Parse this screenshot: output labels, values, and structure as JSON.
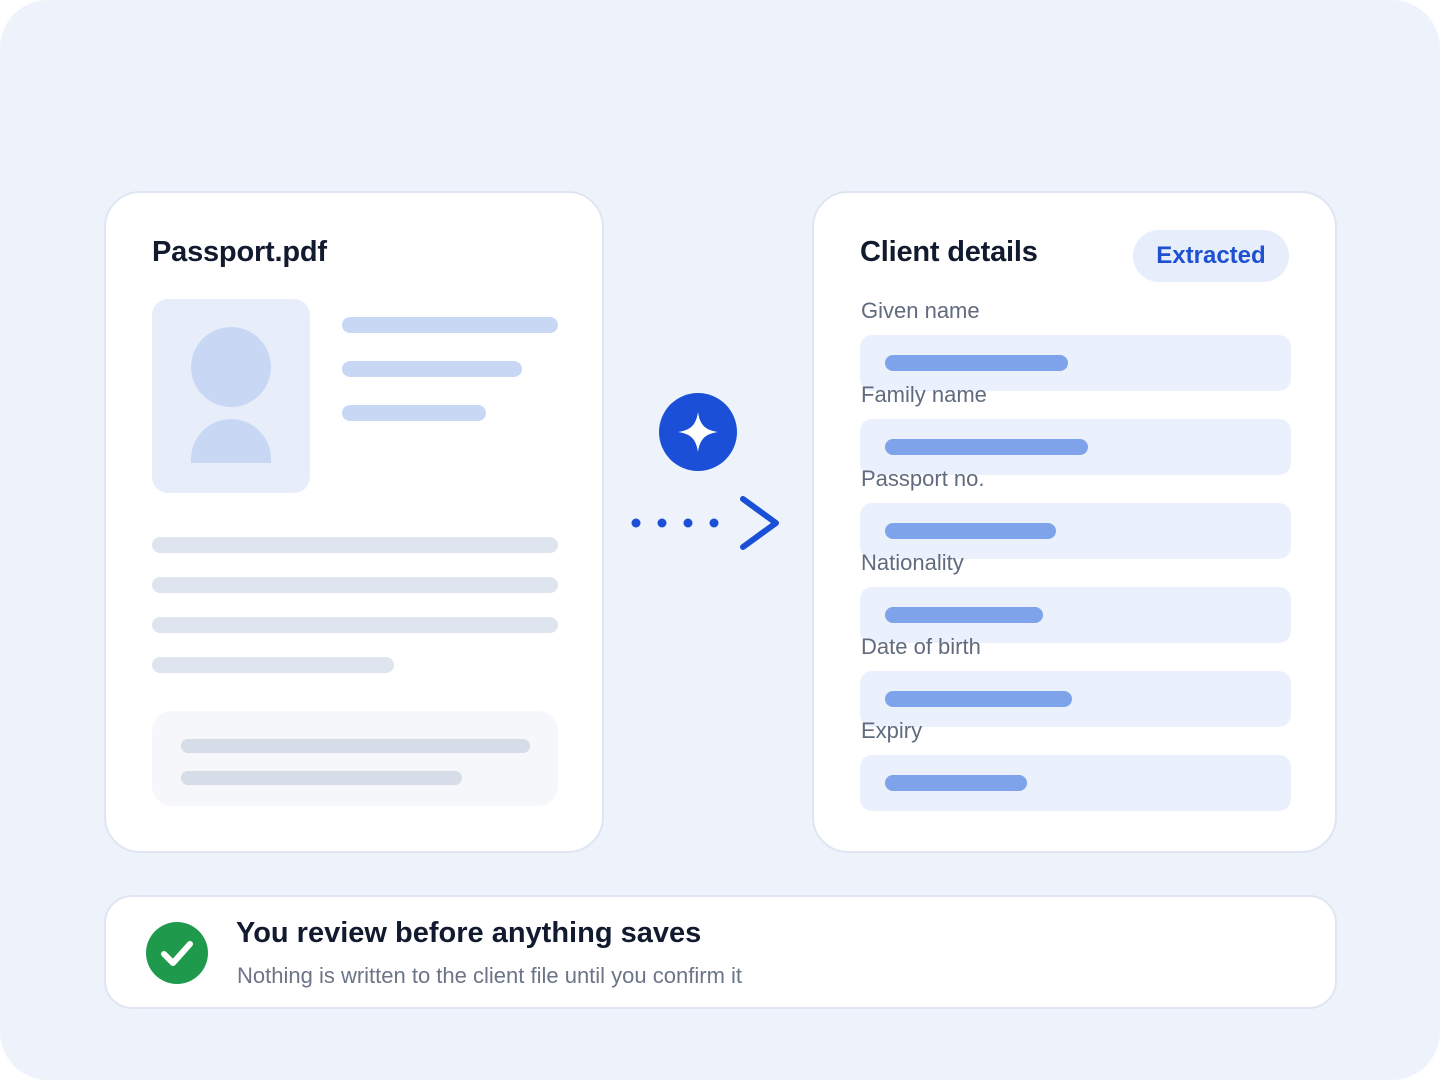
{
  "document": {
    "title": "Passport.pdf"
  },
  "details": {
    "title": "Client details",
    "badge": "Extracted",
    "fields": [
      {
        "label": "Given name",
        "fill": 0.45
      },
      {
        "label": "Family name",
        "fill": 0.5
      },
      {
        "label": "Passport no.",
        "fill": 0.42
      },
      {
        "label": "Nationality",
        "fill": 0.39
      },
      {
        "label": "Date of birth",
        "fill": 0.46
      },
      {
        "label": "Expiry",
        "fill": 0.35
      }
    ]
  },
  "review": {
    "title": "You review before anything saves",
    "subtitle": "Nothing is written to the client file until you confirm it"
  },
  "icons": {
    "extract": "sparkle-icon",
    "flow": "dotted-arrow-icon",
    "confirm": "check-circle-icon"
  },
  "colors": {
    "accent": "#1b4fd8",
    "success": "#1f9a4d",
    "background": "#eef3fb"
  }
}
